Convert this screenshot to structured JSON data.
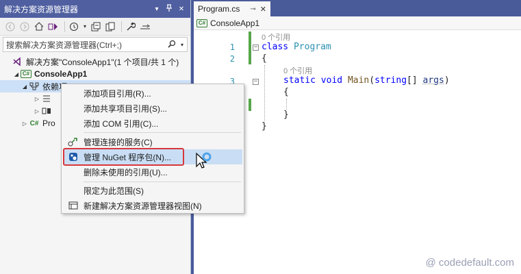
{
  "solution_explorer": {
    "title": "解决方案资源管理器",
    "title_buttons": [
      "▾",
      "⊐",
      "✕"
    ],
    "search_placeholder": "搜索解决方案资源管理器(Ctrl+;)",
    "tree": {
      "solution": "解决方案\"ConsoleApp1\"(1 个项目/共 1 个)",
      "project": "ConsoleApp1",
      "dependencies": "依赖项",
      "program_prefix": "Pro"
    }
  },
  "editor": {
    "tab_label": "Program.cs",
    "nav_project": "ConsoleApp1",
    "codelens_class": "0 个引用",
    "codelens_method": "0 个引用",
    "lines": {
      "l1_num": "1",
      "l1_kw": "class",
      "l1_type": "Program",
      "l2_num": "2",
      "l2_text": "{",
      "l3_num": "3",
      "l3_kw1": "static",
      "l3_kw2": "void",
      "l3_fn": "Main",
      "l3_paren_open": "(",
      "l3_kw3": "string",
      "l3_brackets": "[] ",
      "l3_param": "args",
      "l3_paren_close": ")",
      "l4_text": "{",
      "l6_text": "}",
      "l8_text": "}"
    }
  },
  "context_menu": {
    "items": [
      {
        "label": "添加项目引用(R)...",
        "icon": ""
      },
      {
        "label": "添加共享项目引用(S)...",
        "icon": ""
      },
      {
        "label": "添加 COM 引用(C)...",
        "icon": ""
      },
      {
        "label": "管理连接的服务(C)",
        "icon": "connected-services-icon"
      },
      {
        "label": "管理 NuGet 程序包(N)...",
        "icon": "nuget-icon"
      },
      {
        "label": "删除未使用的引用(U)...",
        "icon": ""
      },
      {
        "label": "限定为此范围(S)",
        "icon": ""
      },
      {
        "label": "新建解决方案资源管理器视图(N)",
        "icon": "new-view-icon"
      }
    ],
    "highlighted_index": 4,
    "highlight_color": "#d9373a"
  },
  "watermark": "@ codedefault.com",
  "colors": {
    "title_bar": "#4f5fa0",
    "selection": "#cce0f7",
    "menu_hover": "#c9def5",
    "keyword": "#0000ff",
    "type": "#2b91af",
    "change_bar": "#57a64a"
  }
}
